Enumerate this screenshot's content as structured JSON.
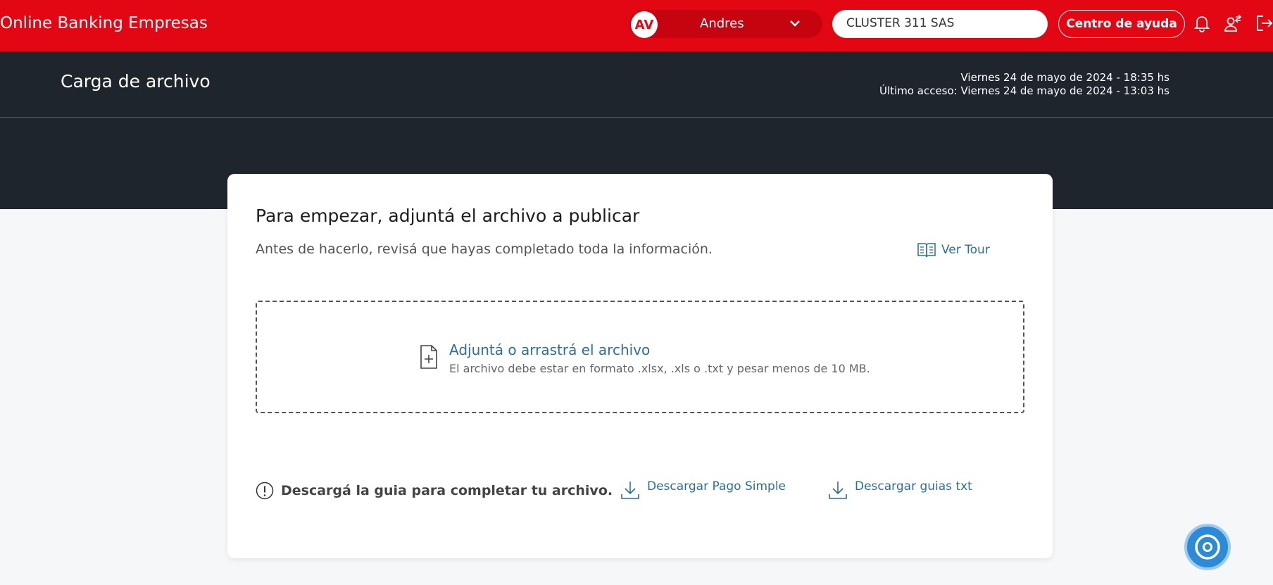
{
  "app": {
    "brand": "Online Banking Empresas",
    "user_initials": "AV",
    "user_name": "Andres",
    "company": "CLUSTER 311 SAS",
    "help_label": "Centro de ayuda",
    "icons": [
      "bell-icon",
      "switch-user-icon",
      "logout-icon"
    ]
  },
  "header": {
    "title": "Carga de archivo",
    "date_line": "Viernes 24 de mayo de 2024 - 18:35 hs",
    "last_access": "Último acceso: Viernes 24 de mayo de 2024 - 13:03 hs"
  },
  "card": {
    "title": "Para empezar, adjuntá el archivo a publicar",
    "subtitle": "Antes de hacerlo, revisá que hayas completado toda la información.",
    "tour_label": "Ver Tour",
    "drop_title": "Adjuntá o arrastrá el archivo",
    "drop_hint": "El archivo debe estar en formato .xlsx, .xls o .txt y pesar menos de 10 MB.",
    "guide_text": "Descargá la guia para completar tu archivo.",
    "download_simple": "Descargar Pago Simple",
    "download_txt": "Descargar guias txt"
  },
  "colors": {
    "brand_red": "#e30613",
    "dark": "#1f252d",
    "link": "#2b6f9c",
    "fab": "#2c8ad6"
  }
}
